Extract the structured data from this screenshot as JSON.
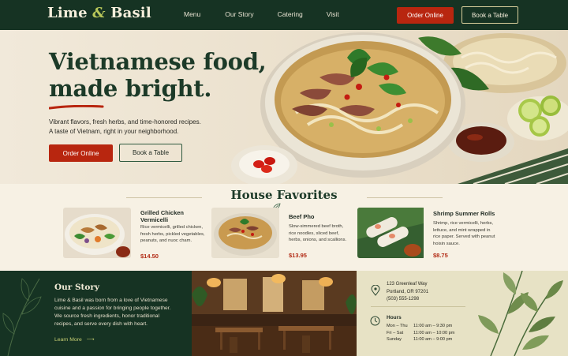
{
  "brand": {
    "name_part1": "Lime",
    "amp": "&",
    "name_part2": "Basil"
  },
  "nav": {
    "links": [
      "Menu",
      "Our Story",
      "Catering",
      "Visit"
    ],
    "order_label": "Order Online",
    "book_label": "Book a Table"
  },
  "hero": {
    "title_line1": "Vietnamese food,",
    "title_line2": "made bright.",
    "sub_line1": "Vibrant flavors, fresh herbs, and time-honored recipes.",
    "sub_line2": "A taste of Vietnam, right in your neighborhood.",
    "order_label": "Order Online",
    "book_label": "Book a Table"
  },
  "favorites": {
    "title": "House Favorites",
    "items": [
      {
        "name_line1": "Grilled Chicken",
        "name_line2": "Vermicelli",
        "desc": [
          "Rice vermicelli, grilled chicken,",
          "fresh herbs, pickled vegetables,",
          "peanuts, and nuoc cham."
        ],
        "price": "$14.50"
      },
      {
        "name_line1": "Beef Pho",
        "name_line2": "",
        "desc": [
          "Slow-simmered beef broth,",
          "rice noodles, sliced beef,",
          "herbs, onions, and scallions."
        ],
        "price": "$13.95"
      },
      {
        "name_line1": "Shrimp Summer Rolls",
        "name_line2": "",
        "desc": [
          "Shrimp, rice vermicelli, herbs,",
          "lettuce, and mint wrapped in",
          "rice paper. Served with peanut",
          "hoisin sauce."
        ],
        "price": "$8.75"
      }
    ]
  },
  "story": {
    "title": "Our Story",
    "lines": [
      "Lime & Basil was born from a love of Vietnamese",
      "cuisine and a passion for bringing people together.",
      "We source fresh ingredients, honor traditional",
      "recipes, and serve every dish with heart."
    ],
    "link": "Learn More",
    "link_arrow": "⟶"
  },
  "visit": {
    "address": [
      "123 Greenleaf Way",
      "Portland, OR 97201",
      "(503) 555-1298"
    ],
    "hours_title": "Hours",
    "hours": [
      {
        "days": "Mon – Thu",
        "time": "11:00 am – 9:30 pm"
      },
      {
        "days": "Fri – Sat",
        "time": "11:00 am – 10:00 pm"
      },
      {
        "days": "Sunday",
        "time": "11:00 am – 9:00 pm"
      }
    ]
  },
  "colors": {
    "nav_bg": "#163323",
    "accent_red": "#b8260f",
    "heading_green": "#1c3a28",
    "price_red": "#b22a14",
    "lime": "#c8cf73"
  },
  "icons": [
    "location-pin-icon",
    "clock-icon",
    "arrow-right-icon",
    "herb-leaf-icon"
  ]
}
